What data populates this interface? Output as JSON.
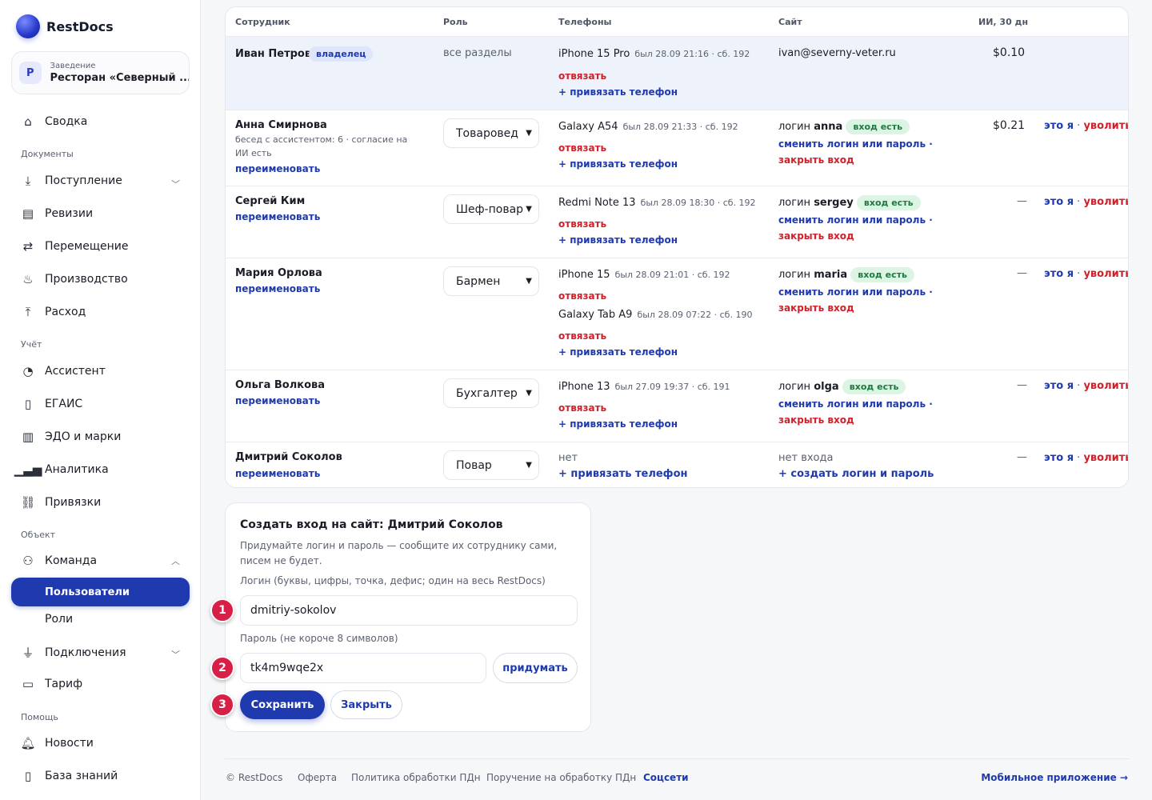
{
  "app": {
    "name": "RestDocs"
  },
  "venue": {
    "caption": "Заведение",
    "name": "Ресторан «Северный ...",
    "avatar": "Р"
  },
  "nav": {
    "summary": "Сводка",
    "sec_docs": "Документы",
    "receipt": "Поступление",
    "revisions": "Ревизии",
    "transfer": "Перемещение",
    "production": "Производство",
    "expense": "Расход",
    "sec_account": "Учёт",
    "assistant": "Ассистент",
    "egais": "ЕГАИС",
    "edo": "ЭДО и марки",
    "analytics": "Аналитика",
    "bindings": "Привязки",
    "sec_object": "Объект",
    "team": "Команда",
    "users": "Пользователи",
    "roles": "Роли",
    "connections": "Подключения",
    "tariff": "Тариф",
    "sec_help": "Помощь",
    "news": "Новости",
    "kb": "База знаний"
  },
  "table": {
    "headers": {
      "employee": "Сотрудник",
      "role": "Роль",
      "phones": "Телефоны",
      "site": "Сайт",
      "ai": "ИИ, 30 дн"
    },
    "common": {
      "unbind": "отвязать",
      "bind_phone": "+ привязать телефон",
      "rename": "переименовать",
      "login_prefix": "логин",
      "login_ok": "вход есть",
      "change_login": "сменить логин или пароль ·",
      "close_login": "закрыть вход",
      "its_me": "это я",
      "sep": " · ",
      "fire": "уволить",
      "dash": "—"
    },
    "rows": [
      {
        "name": "Иван Петров",
        "badge": "владелец",
        "role": "все разделы",
        "device": "iPhone 15 Pro",
        "meta": "был 28.09 21:16 · сб. 192",
        "site": "ivan@severny-veter.ru",
        "ai": "$0.10"
      },
      {
        "name": "Анна Смирнова",
        "sub": "бесед с ассистентом: 6 · согласие на ИИ есть",
        "role": "Товаровед",
        "device": "Galaxy A54",
        "meta": "был 28.09 21:33 · сб. 192",
        "login": "anna",
        "ai": "$0.21"
      },
      {
        "name": "Сергей Ким",
        "role": "Шеф-повар",
        "device": "Redmi Note 13",
        "meta": "был 28.09 18:30 · сб. 192",
        "login": "sergey"
      },
      {
        "name": "Мария Орлова",
        "role": "Бармен",
        "device": "iPhone 15",
        "meta": "был 28.09 21:01 · сб. 192",
        "device2": "Galaxy Tab A9",
        "meta2": "был 28.09 07:22 · сб. 190",
        "login": "maria"
      },
      {
        "name": "Ольга Волкова",
        "role": "Бухгалтер",
        "device": "iPhone 13",
        "meta": "был 27.09 19:37 · сб. 191",
        "login": "olga"
      },
      {
        "name": "Дмитрий Соколов",
        "role": "Повар",
        "device": "нет",
        "site": "нет входа",
        "create_login": "+ создать логин и пароль"
      }
    ]
  },
  "form": {
    "title": "Создать вход на сайт: Дмитрий Соколов",
    "desc": "Придумайте логин и пароль — сообщите их сотруднику сами, писем не будет.",
    "login_label": "Логин (буквы, цифры, точка, дефис; один на весь RestDocs)",
    "login_value": "dmitriy-sokolov",
    "password_label": "Пароль (не короче 8 символов)",
    "password_value": "tk4m9wqe2x",
    "generate": "придумать",
    "save": "Сохранить",
    "close": "Закрыть",
    "steps": [
      "1",
      "2",
      "3"
    ]
  },
  "footer": {
    "copyright": "© RestDocs",
    "offer": "Оферта",
    "policy": "Политика обработки ПДн",
    "assignment": "Поручение на обработку ПДн",
    "social": "Соцсети",
    "mobile": "Мобильное приложение →"
  },
  "colors": {
    "accent": "#1f3aaf",
    "danger": "#d0212b",
    "step": "#d81f46",
    "success_bg": "#dcf4e4"
  }
}
